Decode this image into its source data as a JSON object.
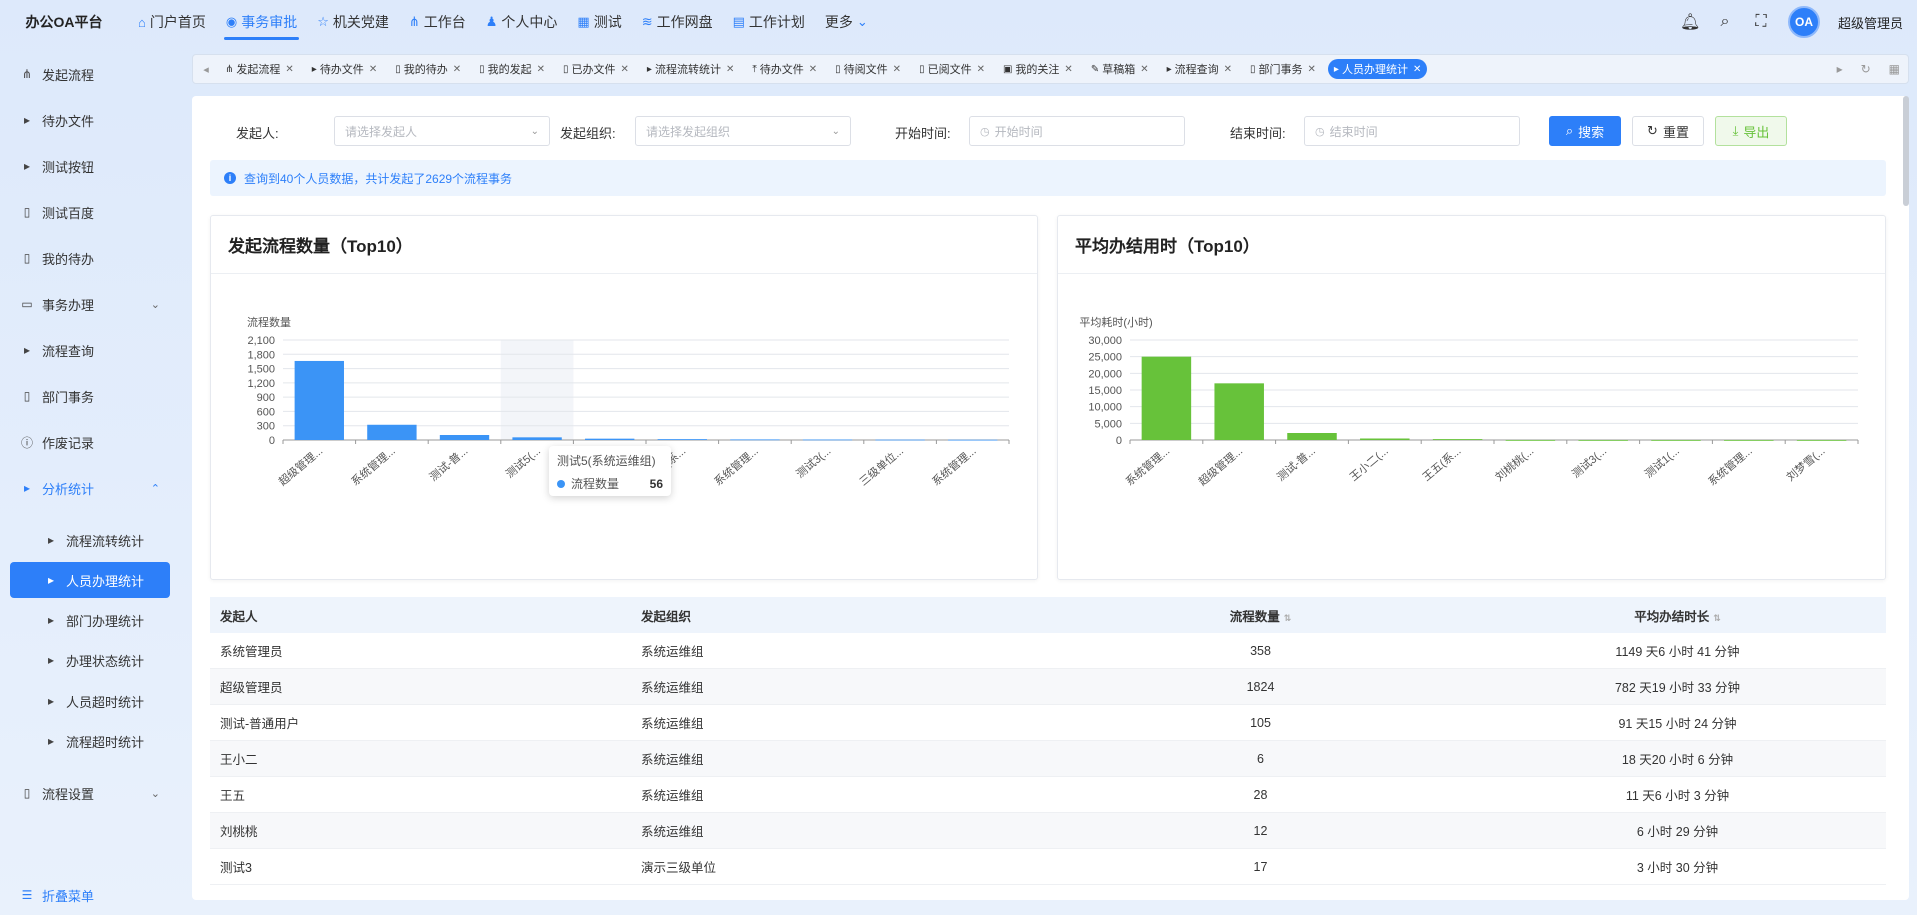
{
  "app": {
    "brand": "办公OA平台",
    "nav": [
      {
        "label": "门户首页",
        "icon": "home-icon"
      },
      {
        "label": "事务审批",
        "icon": "approval-icon"
      },
      {
        "label": "机关党建",
        "icon": "star-icon"
      },
      {
        "label": "工作台",
        "icon": "workbench-icon"
      },
      {
        "label": "个人中心",
        "icon": "user-icon"
      },
      {
        "label": "测试",
        "icon": "grid-icon"
      },
      {
        "label": "工作网盘",
        "icon": "disk-icon"
      },
      {
        "label": "工作计划",
        "icon": "calendar-icon"
      },
      {
        "label": "更多",
        "icon": "chevron-down-icon"
      }
    ],
    "username": "超级管理员",
    "avatar_text": "OA"
  },
  "sidebar": {
    "items": [
      {
        "label": "发起流程"
      },
      {
        "label": "待办文件"
      },
      {
        "label": "测试按钮"
      },
      {
        "label": "测试百度"
      },
      {
        "label": "我的待办"
      },
      {
        "label": "事务办理"
      },
      {
        "label": "流程查询"
      },
      {
        "label": "部门事务"
      },
      {
        "label": "作废记录"
      },
      {
        "label": "分析统计"
      },
      {
        "label": "流程流转统计"
      },
      {
        "label": "人员办理统计"
      },
      {
        "label": "部门办理统计"
      },
      {
        "label": "办理状态统计"
      },
      {
        "label": "人员超时统计"
      },
      {
        "label": "流程超时统计"
      },
      {
        "label": "流程设置"
      }
    ],
    "collapse_label": "折叠菜单"
  },
  "tabs": [
    {
      "label": "发起流程"
    },
    {
      "label": "待办文件"
    },
    {
      "label": "我的待办"
    },
    {
      "label": "我的发起"
    },
    {
      "label": "已办文件"
    },
    {
      "label": "流程流转统计"
    },
    {
      "label": "待办文件"
    },
    {
      "label": "待阅文件"
    },
    {
      "label": "已阅文件"
    },
    {
      "label": "我的关注"
    },
    {
      "label": "草稿箱"
    },
    {
      "label": "流程查询"
    },
    {
      "label": "部门事务"
    },
    {
      "label": "人员办理统计"
    }
  ],
  "filters": {
    "initiator_label": "发起人:",
    "initiator_placeholder": "请选择发起人",
    "org_label": "发起组织:",
    "org_placeholder": "请选择发起组织",
    "start_label": "开始时间:",
    "start_placeholder": "开始时间",
    "end_label": "结束时间:",
    "end_placeholder": "结束时间",
    "search_label": "搜索",
    "reset_label": "重置",
    "export_label": "导出"
  },
  "info": "查询到40个人员数据，共计发起了2629个流程事务",
  "chart_data": [
    {
      "type": "bar",
      "title": "发起流程数量（Top10）",
      "ylabel": "流程数量",
      "categories": [
        "超级管理...",
        "系统管理...",
        "测试-普...",
        "测试5(...",
        "王五",
        "王小二(系...",
        "系统管理...",
        "测试3(...",
        "三级单位...",
        "系统管理..."
      ],
      "values": [
        1660,
        320,
        105,
        56,
        28,
        18,
        12,
        10,
        8,
        6
      ],
      "ylim": [
        0,
        2100
      ],
      "yticks": [
        "0",
        "300",
        "600",
        "900",
        "1,200",
        "1,500",
        "1,800",
        "2,100"
      ],
      "color": "#3b94f6",
      "tooltip": {
        "title": "测试5(系统运维组)",
        "series": "流程数量",
        "value": "56"
      }
    },
    {
      "type": "bar",
      "title": "平均办结用时（Top10）",
      "ylabel": "平均耗时(小时)",
      "categories": [
        "系统管理...",
        "超级管理...",
        "测试-普...",
        "王小二(...",
        "王五(系...",
        "刘桃桃(...",
        "测试3(...",
        "测试1(...",
        "系统管理...",
        "刘梦雪(..."
      ],
      "values": [
        25000,
        17000,
        2100,
        450,
        270,
        6,
        3,
        2,
        1,
        1
      ],
      "ylim": [
        0,
        30000
      ],
      "yticks": [
        "0",
        "5,000",
        "10,000",
        "15,000",
        "20,000",
        "25,000",
        "30,000"
      ],
      "color": "#67c23a"
    }
  ],
  "table": {
    "headers": [
      "发起人",
      "发起组织",
      "流程数量",
      "平均办结时长"
    ],
    "rows": [
      [
        "系统管理员",
        "系统运维组",
        "358",
        "1149 天6 小时 41 分钟"
      ],
      [
        "超级管理员",
        "系统运维组",
        "1824",
        "782 天19 小时 33 分钟"
      ],
      [
        "测试-普通用户",
        "系统运维组",
        "105",
        "91 天15 小时 24 分钟"
      ],
      [
        "王小二",
        "系统运维组",
        "6",
        "18 天20 小时 6 分钟"
      ],
      [
        "王五",
        "系统运维组",
        "28",
        "11 天6 小时 3 分钟"
      ],
      [
        "刘桃桃",
        "系统运维组",
        "12",
        "6 小时 29 分钟"
      ],
      [
        "测试3",
        "演示三级单位",
        "17",
        "3 小时 30 分钟"
      ]
    ]
  }
}
